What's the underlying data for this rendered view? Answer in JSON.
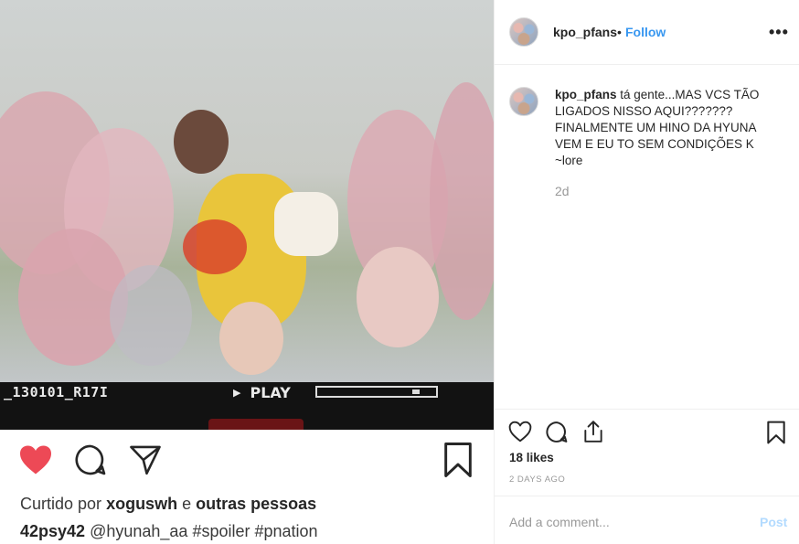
{
  "video": {
    "overlay_code": "_130101_R17I",
    "play_label": "PLAY",
    "progress": 0.85
  },
  "left_actions": {
    "liked_prefix": "Curtido por",
    "liked_user": "xoguswh",
    "liked_and": "e",
    "liked_others": "outras pessoas",
    "tags_user": "42psy42",
    "tags_text": "@hyunah_aa #spoiler #pnation"
  },
  "header": {
    "username": "kpo_pfans",
    "separator": "•",
    "follow_label": "Follow",
    "more_label": "•••"
  },
  "caption": {
    "username": "kpo_pfans",
    "text": "tá gente...MAS VCS TÃO LIGADOS NISSO AQUI??????? FINALMENTE UM HINO DA HYUNA VEM E EU TO SEM CONDIÇÕES K ~lore",
    "time": "2d"
  },
  "stats": {
    "likes": "18 likes",
    "ago": "2 DAYS AGO"
  },
  "comment": {
    "placeholder": "Add a comment...",
    "post_label": "Post"
  },
  "icons": {
    "liked_heart_color": "#ed4956",
    "follow_color": "#3897f0",
    "post_disabled_color": "#b3dbff"
  }
}
